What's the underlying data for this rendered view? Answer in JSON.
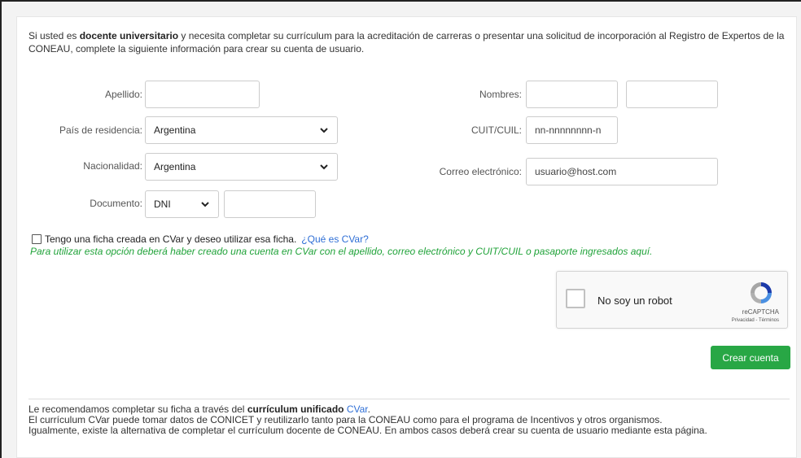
{
  "intro": {
    "part1": "Si usted es ",
    "bold": "docente universitario",
    "part2": " y necesita completar su currículum para la acreditación de carreras o presentar una solicitud de incorporación al Registro de Expertos de la CONEAU, complete la siguiente información para crear su cuenta de usuario."
  },
  "form": {
    "apellido_label": "Apellido:",
    "apellido_value": "",
    "nombres_label": "Nombres:",
    "nombres_value1": "",
    "nombres_value2": "",
    "pais_label": "País de residencia:",
    "pais_value": "Argentina",
    "cuit_label": "CUIT/CUIL:",
    "cuit_placeholder": "nn-nnnnnnnn-n",
    "nacionalidad_label": "Nacionalidad:",
    "nacionalidad_value": "Argentina",
    "correo_label": "Correo electrónico:",
    "correo_placeholder": "usuario@host.com",
    "documento_label": "Documento:",
    "documento_type": "DNI",
    "documento_value": ""
  },
  "cvar_option": {
    "label": "Tengo una ficha creada en CVar y deseo utilizar esa ficha.",
    "link": "¿Qué es CVar?",
    "note": "Para utilizar esta opción deberá haber creado una cuenta en CVar con el apellido, correo electrónico y CUIT/CUIL o pasaporte ingresados aquí."
  },
  "captcha": {
    "label": "No soy un robot",
    "brand": "reCAPTCHA",
    "terms": "Privacidad - Términos"
  },
  "submit_label": "Crear cuenta",
  "footer": {
    "line1_part1": "Le recomendamos completar su ficha a través del ",
    "line1_bold": "currículum unificado",
    "line1_link": "CVar",
    "line1_end": ".",
    "line2": "El currículum CVar puede tomar datos de CONICET y reutilizarlo tanto para la CONEAU como para el programa de Incentivos y otros organismos.",
    "line3": "Igualmente, existe la alternativa de completar el currículum docente de CONEAU. En ambos casos deberá crear su cuenta de usuario mediante esta página."
  },
  "colors": {
    "accent_green": "#28a745",
    "link_blue": "#2f6fd6",
    "note_green": "#21a33a"
  }
}
